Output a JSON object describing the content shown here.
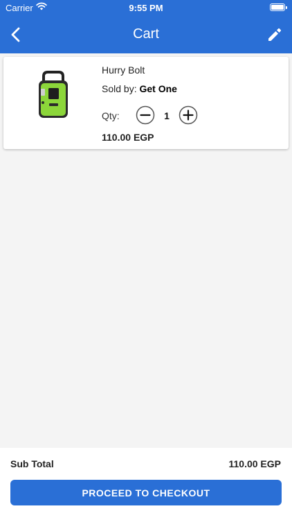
{
  "status_bar": {
    "carrier": "Carrier",
    "time": "9:55 PM"
  },
  "nav": {
    "title": "Cart",
    "back_icon": "chevron-left-icon",
    "edit_icon": "pencil-icon"
  },
  "cart": {
    "items": [
      {
        "name": "Hurry Bolt",
        "sold_by_label": "Sold by:",
        "seller": "Get One",
        "qty_label": "Qty:",
        "quantity": "1",
        "price": "110.00 EGP"
      }
    ]
  },
  "footer": {
    "subtotal_label": "Sub Total",
    "subtotal_value": "110.00 EGP",
    "checkout_label": "PROCEED TO CHECKOUT"
  },
  "colors": {
    "primary": "#2a6fd6",
    "background": "#f4f4f4"
  }
}
